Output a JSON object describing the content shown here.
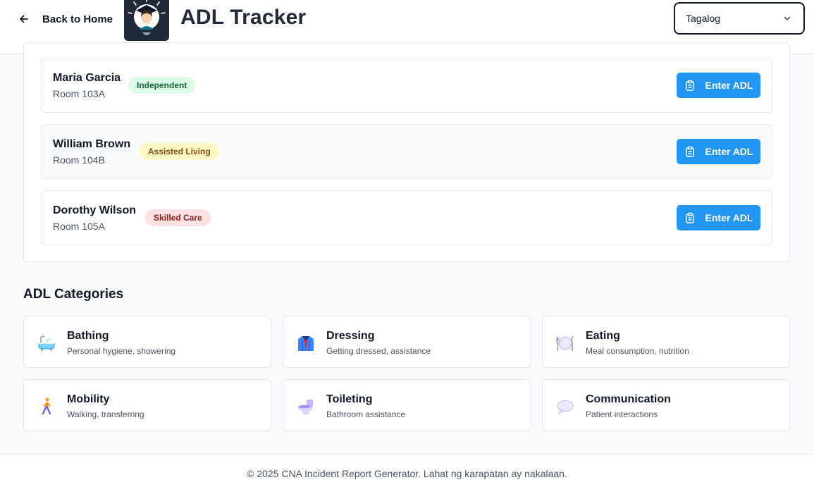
{
  "header": {
    "back_label": "Back to Home",
    "title": "ADL Tracker",
    "language": "Tagalog",
    "logo_icon": "cna-nurse-logo"
  },
  "residents": [
    {
      "name": "Maria Garcia",
      "room": "Room 103A",
      "level": "Independent",
      "level_color": "green",
      "action": "Enter ADL"
    },
    {
      "name": "William Brown",
      "room": "Room 104B",
      "level": "Assisted Living",
      "level_color": "yellow",
      "action": "Enter ADL"
    },
    {
      "name": "Dorothy Wilson",
      "room": "Room 105A",
      "level": "Skilled Care",
      "level_color": "red",
      "action": "Enter ADL"
    }
  ],
  "categories_title": "ADL Categories",
  "categories": [
    {
      "title": "Bathing",
      "desc": "Personal hygiene, showering",
      "icon": "bathtub-icon"
    },
    {
      "title": "Dressing",
      "desc": "Getting dressed, assistance",
      "icon": "coat-icon"
    },
    {
      "title": "Eating",
      "desc": "Meal consumption, nutrition",
      "icon": "plate-cutlery-icon"
    },
    {
      "title": "Mobility",
      "desc": "Walking, transferring",
      "icon": "walking-person-icon"
    },
    {
      "title": "Toileting",
      "desc": "Bathroom assistance",
      "icon": "toilet-icon"
    },
    {
      "title": "Communication",
      "desc": "Patient interactions",
      "icon": "speech-bubble-icon"
    }
  ],
  "footer": {
    "text": "© 2025 CNA Incident Report Generator. Lahat ng karapatan ay nakalaan."
  },
  "colors": {
    "primary": "#2196f3",
    "badge_green_bg": "#dcfce7",
    "badge_yellow_bg": "#fef9c3",
    "badge_red_bg": "#fee2e2"
  }
}
